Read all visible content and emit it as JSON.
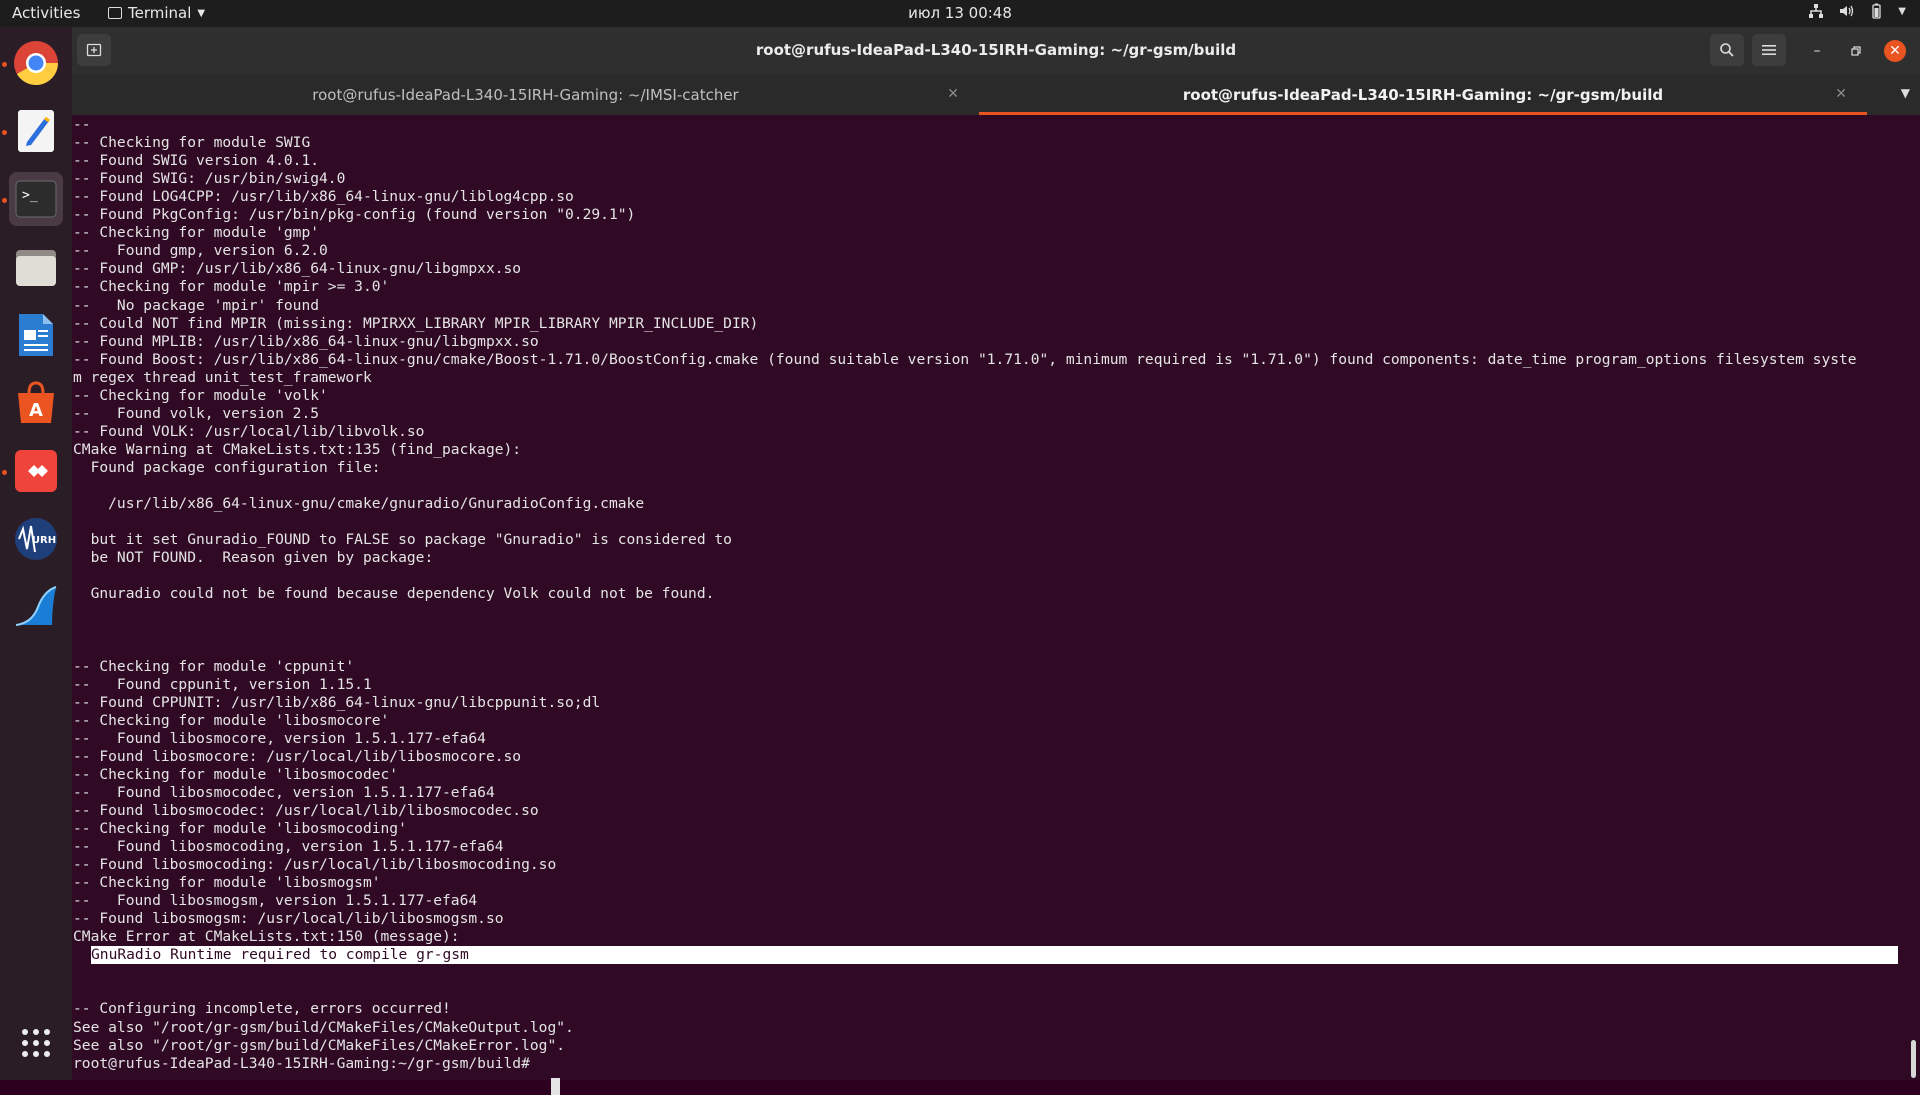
{
  "topbar": {
    "activities": "Activities",
    "app_name": "Terminal",
    "clock": "июл 13  00:48"
  },
  "dock": {
    "items": [
      "chrome-icon",
      "text-editor-icon",
      "terminal-icon",
      "files-icon",
      "writer-icon",
      "software-center-icon",
      "anydesk-icon",
      "urh-icon",
      "wireshark-icon",
      "app-grid-icon"
    ]
  },
  "window": {
    "title": "root@rufus-IdeaPad-L340-15IRH-Gaming: ~/gr-gsm/build",
    "tabs": [
      {
        "label": "root@rufus-IdeaPad-L340-15IRH-Gaming: ~/IMSI-catcher",
        "active": false
      },
      {
        "label": "root@rufus-IdeaPad-L340-15IRH-Gaming: ~/gr-gsm/build",
        "active": true
      }
    ]
  },
  "terminal": {
    "lines": [
      "--",
      "-- Checking for module SWIG",
      "-- Found SWIG version 4.0.1.",
      "-- Found SWIG: /usr/bin/swig4.0",
      "-- Found LOG4CPP: /usr/lib/x86_64-linux-gnu/liblog4cpp.so",
      "-- Found PkgConfig: /usr/bin/pkg-config (found version \"0.29.1\")",
      "-- Checking for module 'gmp'",
      "--   Found gmp, version 6.2.0",
      "-- Found GMP: /usr/lib/x86_64-linux-gnu/libgmpxx.so",
      "-- Checking for module 'mpir >= 3.0'",
      "--   No package 'mpir' found",
      "-- Could NOT find MPIR (missing: MPIRXX_LIBRARY MPIR_LIBRARY MPIR_INCLUDE_DIR)",
      "-- Found MPLIB: /usr/lib/x86_64-linux-gnu/libgmpxx.so",
      "-- Found Boost: /usr/lib/x86_64-linux-gnu/cmake/Boost-1.71.0/BoostConfig.cmake (found suitable version \"1.71.0\", minimum required is \"1.71.0\") found components: date_time program_options filesystem syste",
      "m regex thread unit_test_framework",
      "-- Checking for module 'volk'",
      "--   Found volk, version 2.5",
      "-- Found VOLK: /usr/local/lib/libvolk.so",
      "CMake Warning at CMakeLists.txt:135 (find_package):",
      "  Found package configuration file:",
      "",
      "    /usr/lib/x86_64-linux-gnu/cmake/gnuradio/GnuradioConfig.cmake",
      "",
      "  but it set Gnuradio_FOUND to FALSE so package \"Gnuradio\" is considered to",
      "  be NOT FOUND.  Reason given by package:",
      "",
      "  Gnuradio could not be found because dependency Volk could not be found.",
      "",
      "",
      "",
      "-- Checking for module 'cppunit'",
      "--   Found cppunit, version 1.15.1",
      "-- Found CPPUNIT: /usr/lib/x86_64-linux-gnu/libcppunit.so;dl",
      "-- Checking for module 'libosmocore'",
      "--   Found libosmocore, version 1.5.1.177-efa64",
      "-- Found libosmocore: /usr/local/lib/libosmocore.so",
      "-- Checking for module 'libosmocodec'",
      "--   Found libosmocodec, version 1.5.1.177-efa64",
      "-- Found libosmocodec: /usr/local/lib/libosmocodec.so",
      "-- Checking for module 'libosmocoding'",
      "--   Found libosmocoding, version 1.5.1.177-efa64",
      "-- Found libosmocoding: /usr/local/lib/libosmocoding.so",
      "-- Checking for module 'libosmogsm'",
      "--   Found libosmogsm, version 1.5.1.177-efa64",
      "-- Found libosmogsm: /usr/local/lib/libosmogsm.so",
      "CMake Error at CMakeLists.txt:150 (message):"
    ],
    "highlighted": "GnuRadio Runtime required to compile gr-gsm",
    "tail_lines": [
      "",
      "",
      "-- Configuring incomplete, errors occurred!",
      "See also \"/root/gr-gsm/build/CMakeFiles/CMakeOutput.log\".",
      "See also \"/root/gr-gsm/build/CMakeFiles/CMakeError.log\".",
      "root@rufus-IdeaPad-L340-15IRH-Gaming:~/gr-gsm/build# "
    ]
  }
}
